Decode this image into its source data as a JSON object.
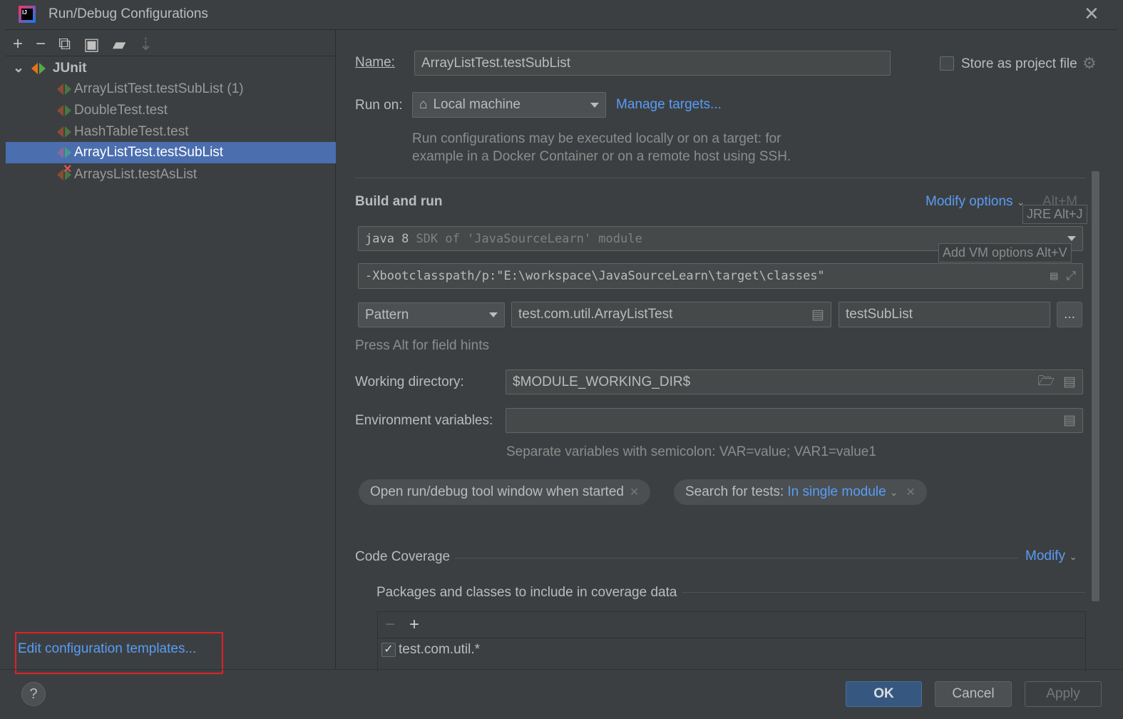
{
  "window": {
    "title": "Run/Debug Configurations",
    "close_icon": "close-icon"
  },
  "toolbar": {
    "icons": [
      "add-icon",
      "remove-icon",
      "copy-icon",
      "save-icon",
      "new-folder-icon",
      "sort-icon"
    ]
  },
  "tree": {
    "root": "JUnit",
    "items": [
      {
        "label": "ArrayListTest.testSubList (1)",
        "selected": false,
        "error": false
      },
      {
        "label": "DoubleTest.test",
        "selected": false,
        "error": false
      },
      {
        "label": "HashTableTest.test",
        "selected": false,
        "error": false
      },
      {
        "label": "ArrayListTest.testSubList",
        "selected": true,
        "error": false
      },
      {
        "label": "ArraysList.testAsList",
        "selected": false,
        "error": true
      }
    ]
  },
  "edit_templates": "Edit configuration templates...",
  "form": {
    "name_label": "Name:",
    "name_value": "ArrayListTest.testSubList",
    "store_label": "Store as project file",
    "store_checked": false,
    "run_on_label": "Run on:",
    "run_on_value": "Local machine",
    "manage_targets": "Manage targets...",
    "run_on_hint_1": "Run configurations may be executed locally or on a target: for",
    "run_on_hint_2": "example in a Docker Container or on a remote host using SSH.",
    "build_run": "Build and run",
    "modify_options": "Modify options",
    "modify_shortcut": "Alt+M",
    "jre_tip": "JRE Alt+J",
    "vm_tip": "Add VM options Alt+V",
    "jre_value": "java 8",
    "jre_hint": "SDK of 'JavaSourceLearn' module",
    "vm_options": "-Xbootclasspath/p:\"E:\\workspace\\JavaSourceLearn\\target\\classes\"",
    "test_kind": "Pattern",
    "test_class": "test.com.util.ArrayListTest",
    "test_method": "testSubList",
    "more": "...",
    "field_hints": "Press Alt for field hints",
    "workdir_label": "Working directory:",
    "workdir_value": "$MODULE_WORKING_DIR$",
    "env_label": "Environment variables:",
    "env_value": "",
    "env_hint": "Separate variables with semicolon: VAR=value; VAR1=value1",
    "chip_open": "Open run/debug tool window when started",
    "chip_search_label": "Search for tests:",
    "chip_search_value": "In single module",
    "coverage_title": "Code Coverage",
    "coverage_modify": "Modify",
    "packages_title": "Packages and classes to include in coverage data",
    "packages": [
      {
        "pattern": "test.com.util.*",
        "checked": true
      }
    ]
  },
  "footer": {
    "help": "?",
    "ok": "OK",
    "cancel": "Cancel",
    "apply": "Apply"
  },
  "colors": {
    "bg": "#3c3f41",
    "accent": "#589df6",
    "selection": "#4b6eaf",
    "ok": "#365880",
    "error": "#e05555"
  }
}
